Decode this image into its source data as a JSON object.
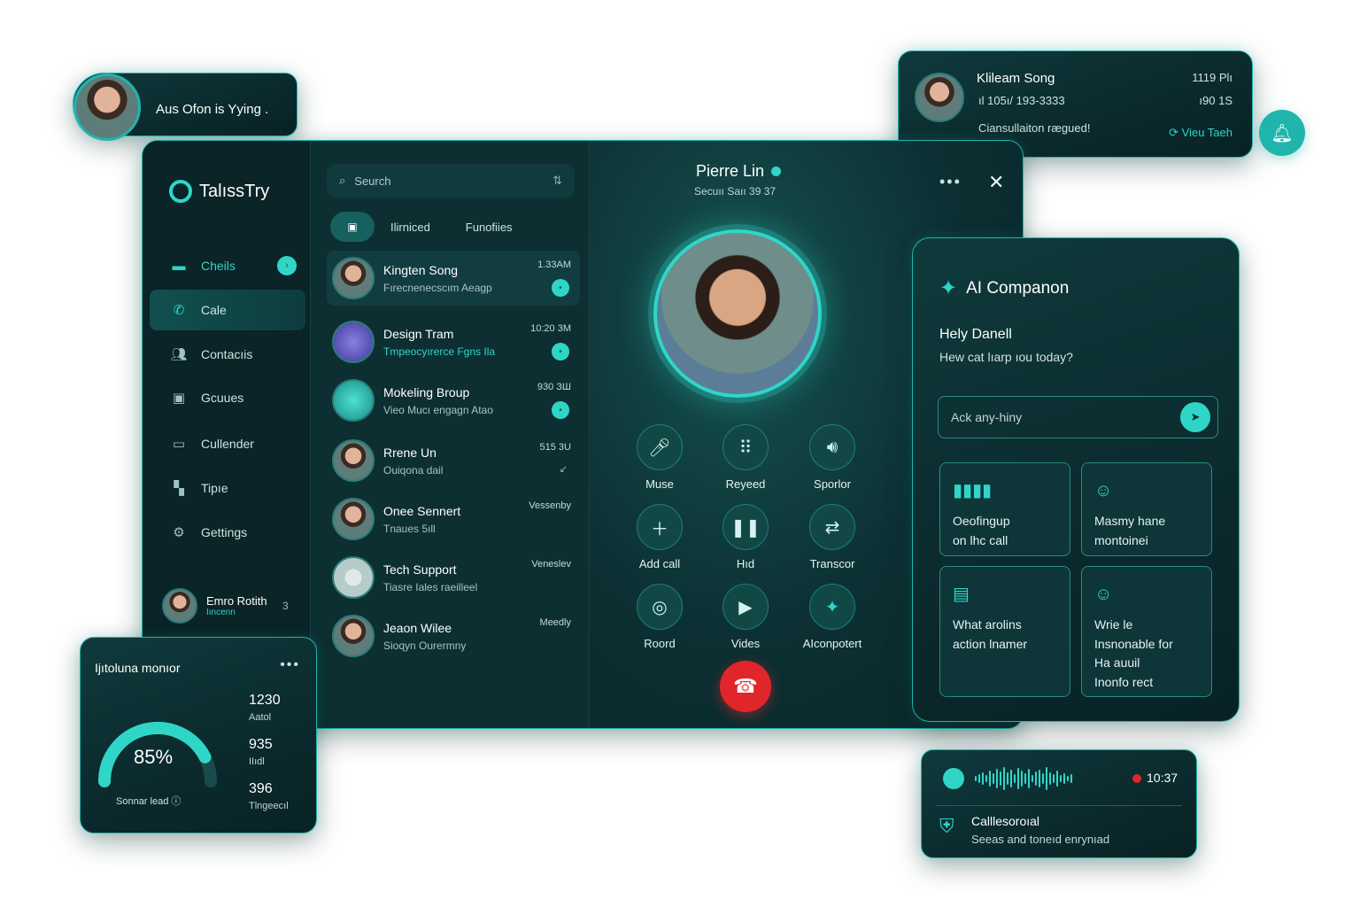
{
  "typing_toast": {
    "text": "Aus Ofon is Yying .",
    "sub": ""
  },
  "notification": {
    "name": "Klileam Song",
    "phone": "ıl 105ı/ 193-3333",
    "message": "Ciansullaiton rægued!",
    "time": "1119 Plı",
    "sub_time": "ı90 1S",
    "action": "Vieu Taeh"
  },
  "sidebar": {
    "brand": "TalıssTry",
    "items": [
      {
        "label": "Cheils",
        "icon": "chat-icon"
      },
      {
        "label": "Cale",
        "icon": "phone-icon"
      },
      {
        "label": "Contacıis",
        "icon": "contacts-icon"
      },
      {
        "label": "Gcuues",
        "icon": "groups-icon"
      },
      {
        "label": "Cullender",
        "icon": "calendar-icon"
      },
      {
        "label": "Tipıe",
        "icon": "tips-icon"
      },
      {
        "label": "Gettings",
        "icon": "gear-icon"
      }
    ],
    "user": {
      "name": "Emro Rotith",
      "sub": "Iıncenn",
      "count": "3"
    }
  },
  "chat_list": {
    "search_placeholder": "Seurch",
    "tabs": [
      "Ilirniced",
      "Funofiies"
    ],
    "chats": [
      {
        "name": "Kingten Song",
        "preview": "Fırecnenecscım Aeagp",
        "time": "1.33AM",
        "unread": "•"
      },
      {
        "name": "Design Tram",
        "preview": "Tmpeocyırerce Fgns Ila",
        "time": "10:20 3M",
        "unread": "•"
      },
      {
        "name": "Mokeling Broup",
        "preview": "Vieo Mucı engagn Atao",
        "time": "930 ЗШ",
        "unread": "•"
      },
      {
        "name": "Rrene Un",
        "preview": "Ouiqona dail",
        "time": "515 3U",
        "unread": ""
      },
      {
        "name": "Onee Sennert",
        "preview": "Tnaues 5ıll",
        "time": "Vessenby",
        "unread": ""
      },
      {
        "name": "Tech Support",
        "preview": "Tiasre Iales raeilleel",
        "time": "Veneslev",
        "unread": ""
      },
      {
        "name": "Jeaon Wilee",
        "preview": "Sioqyn Ourermny",
        "time": "Meedly",
        "unread": ""
      }
    ]
  },
  "call": {
    "name": "Pierre Lin",
    "status": "Secuıı Saıı 39 37",
    "controls": [
      {
        "label": "Muse",
        "icon": "mic-icon"
      },
      {
        "label": "Reyeed",
        "icon": "keypad-icon"
      },
      {
        "label": "Sporlor",
        "icon": "speaker-icon"
      },
      {
        "label": "Add call",
        "icon": "add-icon"
      },
      {
        "label": "Hıd",
        "icon": "hold-icon"
      },
      {
        "label": "Transcor",
        "icon": "transfer-icon"
      },
      {
        "label": "Roord",
        "icon": "record-icon"
      },
      {
        "label": "Vides",
        "icon": "video-icon"
      },
      {
        "label": "AIconpotert",
        "icon": "ai-icon"
      }
    ]
  },
  "ai": {
    "title": "AI Companon",
    "greeting": "Hely Danell",
    "question": "Hew cat lıarp ıou today?",
    "placeholder": "Ack any-hiny",
    "cards": [
      {
        "line1": "Oeofingup",
        "line2": "on lhc call",
        "icon": "waveform-icon"
      },
      {
        "line1": "Masmy hane",
        "line2": "montoinei",
        "icon": "user-icon"
      },
      {
        "line1": "What arolins",
        "line2": "action lnamer",
        "icon": "clipboard-icon"
      },
      {
        "line1": "Wrie le",
        "line2": "Insnonable for",
        "line3": "Ha auuil",
        "line4": "Inonfo rect",
        "icon": "person-icon"
      }
    ]
  },
  "monitor": {
    "title": "Ijıtoluna monıor",
    "percent": "85%",
    "percent_value": 0.85,
    "caption": "Sonnar lead",
    "stats": [
      {
        "value": "1230",
        "label": "Aatol"
      },
      {
        "value": "935",
        "label": "IIıdl"
      },
      {
        "value": "396",
        "label": "Tlngeecıl"
      }
    ]
  },
  "recorder": {
    "timer": "10:37",
    "title": "Calllesoroıal",
    "subtitle": "Seeas and toneıd enrynıad"
  }
}
